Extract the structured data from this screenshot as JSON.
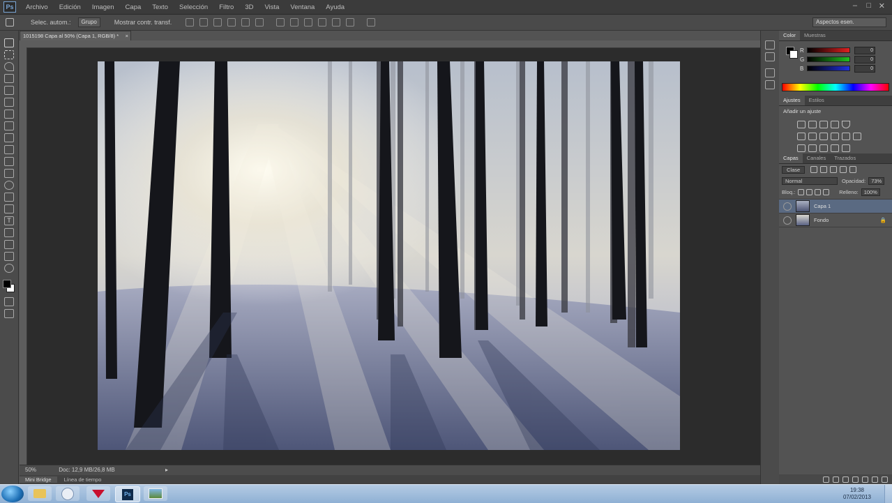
{
  "app": {
    "logo": "Ps"
  },
  "menu": [
    "Archivo",
    "Edición",
    "Imagen",
    "Capa",
    "Texto",
    "Selección",
    "Filtro",
    "3D",
    "Vista",
    "Ventana",
    "Ayuda"
  ],
  "options": {
    "tool_label": "Selec. autom.:",
    "tool_mode": "Grupo",
    "show_controls": "Mostrar contr. transf.",
    "workspace": "Aspectos esen."
  },
  "document": {
    "tab_title": "1015198 Capa al 50% (Capa 1, RGB/8) *",
    "zoom": "50%",
    "doc_size": "Doc: 12,9 MB/26,8 MB"
  },
  "minibar": {
    "tabs": [
      "Mini Bridge",
      "Línea de tiempo"
    ]
  },
  "color_panel": {
    "tabs": [
      "Color",
      "Muestras"
    ],
    "sliders": [
      {
        "label": "R",
        "value": "0",
        "color": "#c0392b"
      },
      {
        "label": "G",
        "value": "0",
        "color": "#27ae60"
      },
      {
        "label": "B",
        "value": "0",
        "color": "#2c3e9c"
      }
    ]
  },
  "adjust_panel": {
    "tabs": [
      "Ajustes",
      "Estilos"
    ],
    "title": "Añadir un ajuste"
  },
  "layers_panel": {
    "tabs": [
      "Capas",
      "Canales",
      "Trazados"
    ],
    "kind_label": "Clase",
    "blend_mode": "Normal",
    "opacity_label": "Opacidad:",
    "opacity": "73%",
    "lock_label": "Bloq.:",
    "fill_label": "Relleno:",
    "fill": "100%",
    "layers": [
      {
        "name": "Capa 1",
        "selected": true
      },
      {
        "name": "Fondo",
        "selected": false
      }
    ]
  },
  "taskbar": {
    "time": "19:38",
    "date": "07/02/2013"
  }
}
